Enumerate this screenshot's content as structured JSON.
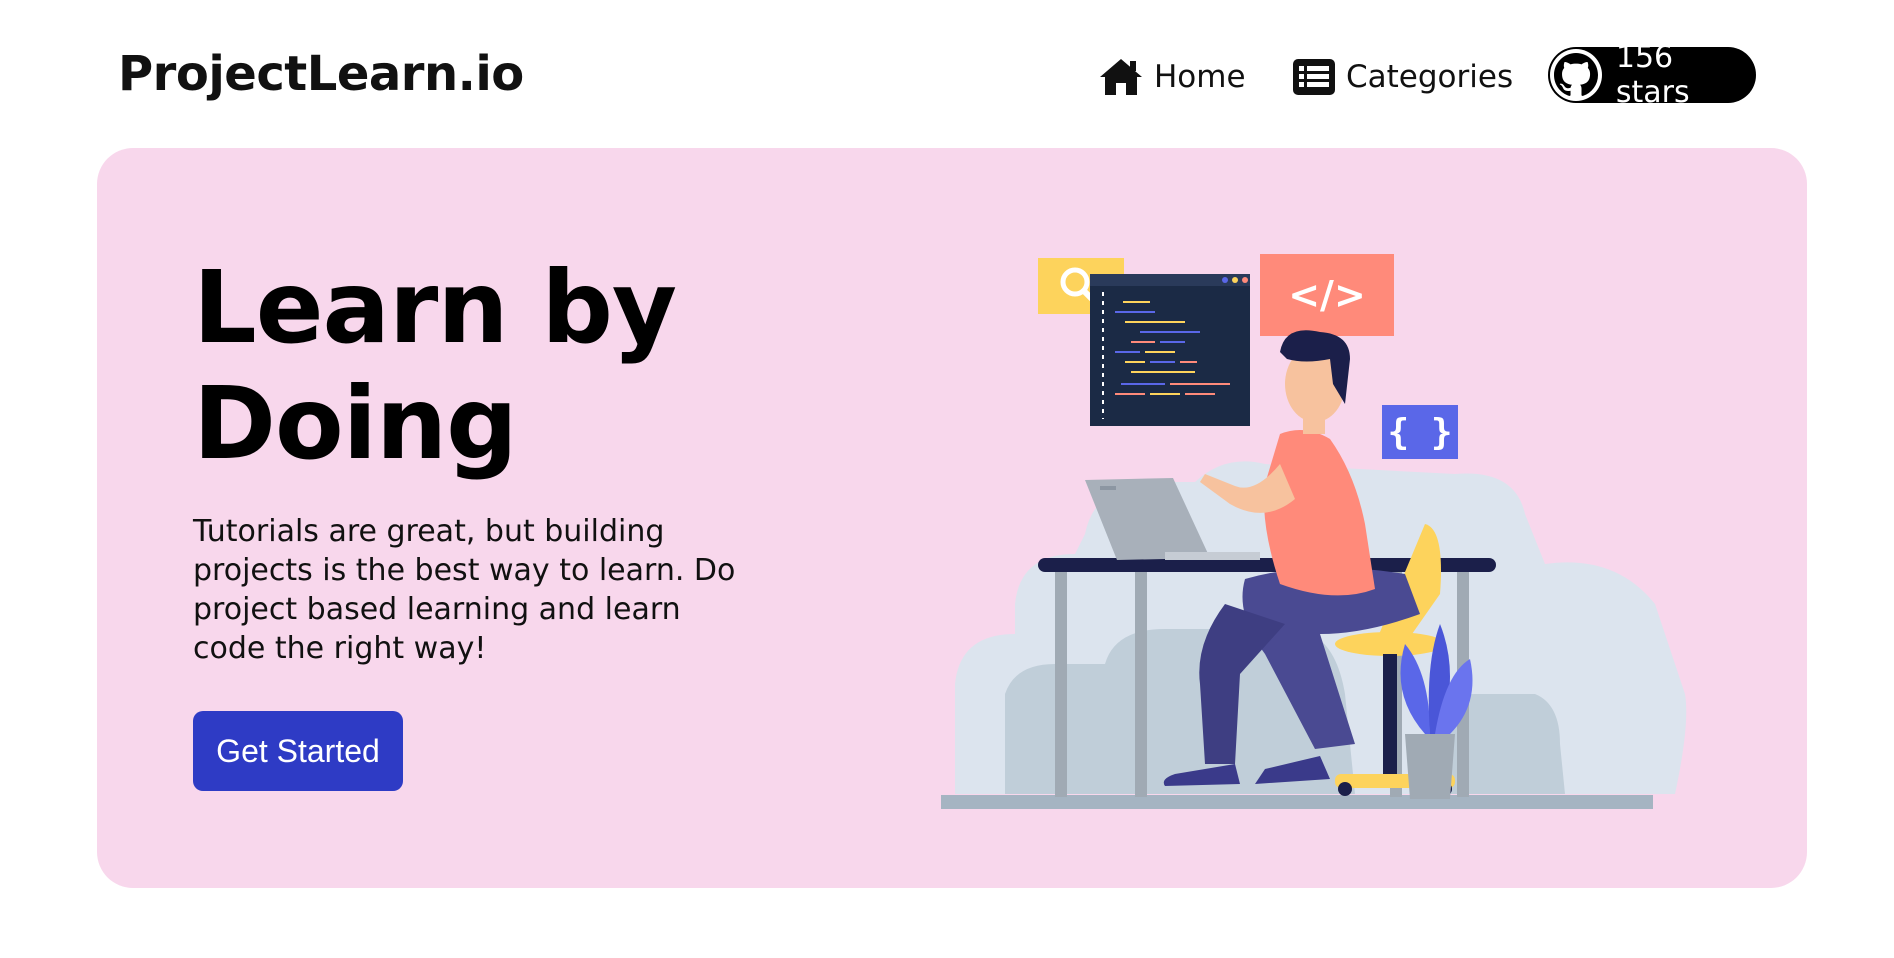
{
  "header": {
    "brand": "ProjectLearn.io",
    "nav": [
      {
        "label": "Home",
        "icon": "home-icon"
      },
      {
        "label": "Categories",
        "icon": "list-icon"
      }
    ],
    "github": {
      "label": "156 stars",
      "icon": "github-icon"
    }
  },
  "hero": {
    "title_line1": "Learn by",
    "title_line2": "Doing",
    "description": "Tutorials are great, but building projects is the best way to learn. Do project based learning and learn code the right way!",
    "cta_label": "Get Started",
    "illustration": {
      "search_card_icon": "search-icon",
      "code_tag_text": "</>",
      "braces_text": "{ }"
    }
  },
  "colors": {
    "hero_background": "#f8d7ec",
    "cta_background": "#2e3bc5",
    "code_card": "#ff8a7a",
    "braces_card": "#5a67e8",
    "search_card": "#fdd35c",
    "monitor": "#1b2a45"
  }
}
